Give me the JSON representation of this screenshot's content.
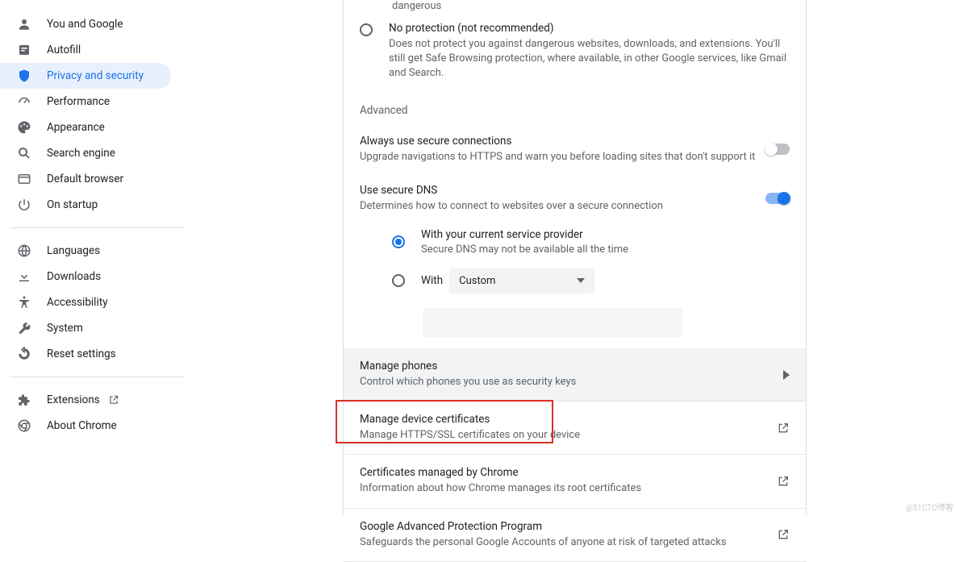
{
  "sidebar": {
    "group1": [
      {
        "label": "You and Google",
        "name": "sidebar-item-you-google"
      },
      {
        "label": "Autofill",
        "name": "sidebar-item-autofill"
      },
      {
        "label": "Privacy and security",
        "name": "sidebar-item-privacy",
        "active": true
      },
      {
        "label": "Performance",
        "name": "sidebar-item-performance"
      },
      {
        "label": "Appearance",
        "name": "sidebar-item-appearance"
      },
      {
        "label": "Search engine",
        "name": "sidebar-item-search-engine"
      },
      {
        "label": "Default browser",
        "name": "sidebar-item-default-browser"
      },
      {
        "label": "On startup",
        "name": "sidebar-item-startup"
      }
    ],
    "group2": [
      {
        "label": "Languages",
        "name": "sidebar-item-languages"
      },
      {
        "label": "Downloads",
        "name": "sidebar-item-downloads"
      },
      {
        "label": "Accessibility",
        "name": "sidebar-item-accessibility"
      },
      {
        "label": "System",
        "name": "sidebar-item-system"
      },
      {
        "label": "Reset settings",
        "name": "sidebar-item-reset"
      }
    ],
    "group3": [
      {
        "label": "Extensions",
        "name": "sidebar-item-extensions",
        "external": true
      },
      {
        "label": "About Chrome",
        "name": "sidebar-item-about"
      }
    ]
  },
  "main": {
    "dangerous": "dangerous",
    "no_protection": {
      "title": "No protection (not recommended)",
      "desc": "Does not protect you against dangerous websites, downloads, and extensions. You'll still get Safe Browsing protection, where available, in other Google services, like Gmail and Search."
    },
    "advanced_header": "Advanced",
    "secure_conn": {
      "title": "Always use secure connections",
      "desc": "Upgrade navigations to HTTPS and warn you before loading sites that don't support it"
    },
    "secure_dns": {
      "title": "Use secure DNS",
      "desc": "Determines how to connect to websites over a secure connection",
      "opt1_label": "With your current service provider",
      "opt1_desc": "Secure DNS may not be available all the time",
      "opt2_label": "With",
      "dropdown": "Custom"
    },
    "rows": {
      "phones": {
        "title": "Manage phones",
        "desc": "Control which phones you use as security keys"
      },
      "certs": {
        "title": "Manage device certificates",
        "desc": "Manage HTTPS/SSL certificates on your device"
      },
      "chrome_certs": {
        "title": "Certificates managed by Chrome",
        "desc": "Information about how Chrome manages its root certificates"
      },
      "gapp": {
        "title": "Google Advanced Protection Program",
        "desc": "Safeguards the personal Google Accounts of anyone at risk of targeted attacks"
      }
    }
  },
  "watermark": "@51CTO博客"
}
